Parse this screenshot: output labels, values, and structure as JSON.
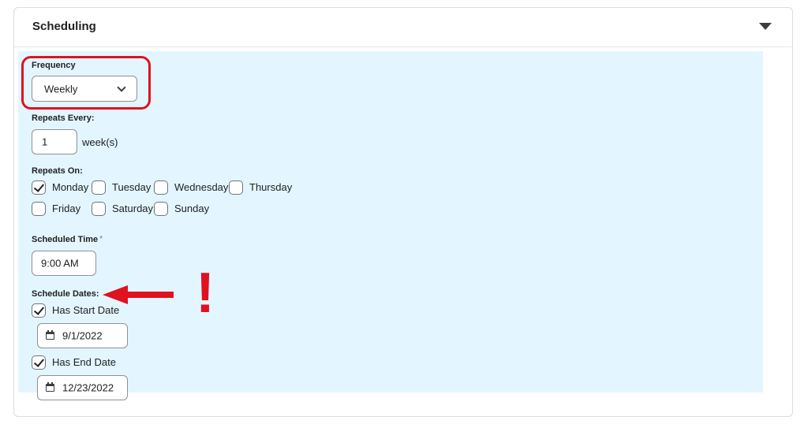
{
  "panel": {
    "title": "Scheduling"
  },
  "frequency": {
    "label": "Frequency",
    "value": "Weekly"
  },
  "repeats_every": {
    "label": "Repeats Every:",
    "value": "1",
    "unit": "week(s)"
  },
  "repeats_on": {
    "label": "Repeats On:",
    "days": [
      {
        "label": "Monday",
        "checked": true
      },
      {
        "label": "Tuesday",
        "checked": false
      },
      {
        "label": "Wednesday",
        "checked": false
      },
      {
        "label": "Thursday",
        "checked": false
      },
      {
        "label": "Friday",
        "checked": false
      },
      {
        "label": "Saturday",
        "checked": false
      },
      {
        "label": "Sunday",
        "checked": false
      }
    ]
  },
  "scheduled_time": {
    "label": "Scheduled Time",
    "required_mark": "*",
    "value": "9:00 AM"
  },
  "schedule_dates": {
    "label": "Schedule Dates:",
    "has_start": {
      "label": "Has Start Date",
      "checked": true,
      "date": "9/1/2022"
    },
    "has_end": {
      "label": "Has End Date",
      "checked": true,
      "date": "12/23/2022"
    }
  },
  "annotation": {
    "exclaim": "!",
    "color": "#e0121f"
  }
}
